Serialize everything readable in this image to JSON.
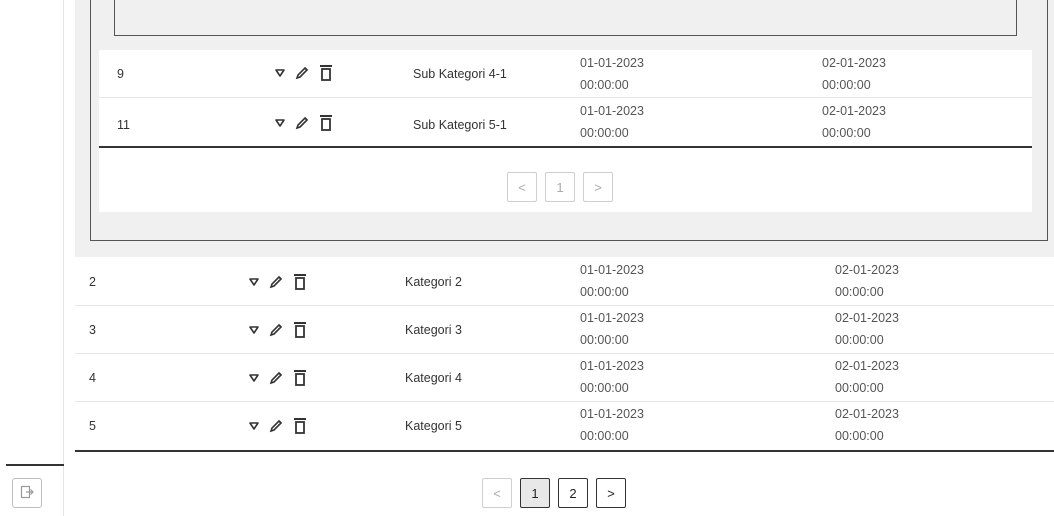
{
  "sub_table": {
    "rows": [
      {
        "id": "9",
        "name": "Sub Kategori 4-1",
        "created_date": "01-01-2023",
        "created_time": "00:00:00",
        "updated_date": "02-01-2023",
        "updated_time": "00:00:00"
      },
      {
        "id": "11",
        "name": "Sub Kategori 5-1",
        "created_date": "01-01-2023",
        "created_time": "00:00:00",
        "updated_date": "02-01-2023",
        "updated_time": "00:00:00"
      }
    ],
    "pagination": {
      "prev": "<",
      "current": "1",
      "next": ">"
    }
  },
  "main_table": {
    "rows": [
      {
        "id": "2",
        "name": "Kategori 2",
        "created_date": "01-01-2023",
        "created_time": "00:00:00",
        "updated_date": "02-01-2023",
        "updated_time": "00:00:00"
      },
      {
        "id": "3",
        "name": "Kategori 3",
        "created_date": "01-01-2023",
        "created_time": "00:00:00",
        "updated_date": "02-01-2023",
        "updated_time": "00:00:00"
      },
      {
        "id": "4",
        "name": "Kategori 4",
        "created_date": "01-01-2023",
        "created_time": "00:00:00",
        "updated_date": "02-01-2023",
        "updated_time": "00:00:00"
      },
      {
        "id": "5",
        "name": "Kategori 5",
        "created_date": "01-01-2023",
        "created_time": "00:00:00",
        "updated_date": "02-01-2023",
        "updated_time": "00:00:00"
      }
    ],
    "pagination": {
      "prev": "<",
      "page1": "1",
      "page2": "2",
      "next": ">"
    }
  },
  "icons": {
    "expand": "triangle-down-icon",
    "edit": "pencil-icon",
    "delete": "trash-icon",
    "logout": "logout-icon"
  }
}
